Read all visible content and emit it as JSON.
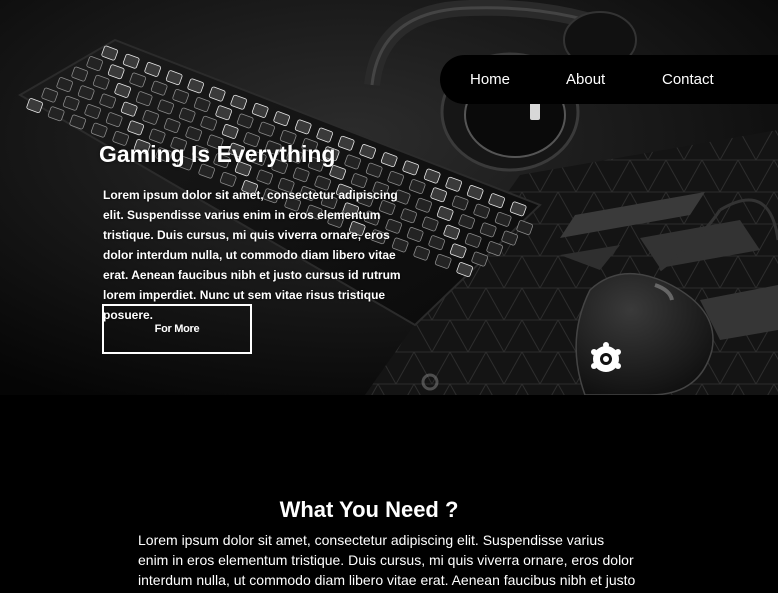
{
  "nav": {
    "links": [
      "Home",
      "About",
      "Contact"
    ]
  },
  "hero": {
    "title": "Gaming Is Everything",
    "text": "Lorem ipsum dolor sit amet, consectetur adipiscing elit. Suspendisse varius enim in eros elementum tristique. Duis cursus, mi quis viverra ornare, eros dolor interdum nulla, ut commodo diam libero vitae erat. Aenean faucibus nibh et justo cursus id rutrum lorem imperdiet. Nunc ut sem vitae risus tristique posuere.",
    "button_label": "For More"
  },
  "section": {
    "title": "What You Need ?",
    "text": "Lorem ipsum dolor sit amet, consectetur adipiscing elit. Suspendisse varius enim in eros elementum tristique. Duis cursus, mi quis viverra ornare, eros dolor interdum nulla, ut commodo diam libero vitae erat. Aenean faucibus nibh et justo"
  },
  "colors": {
    "background": "#000000",
    "text": "#ffffff",
    "nav_background": "#000000",
    "key_glow": "#ffffff"
  },
  "icons": [
    "steelseries-logo-icon"
  ]
}
